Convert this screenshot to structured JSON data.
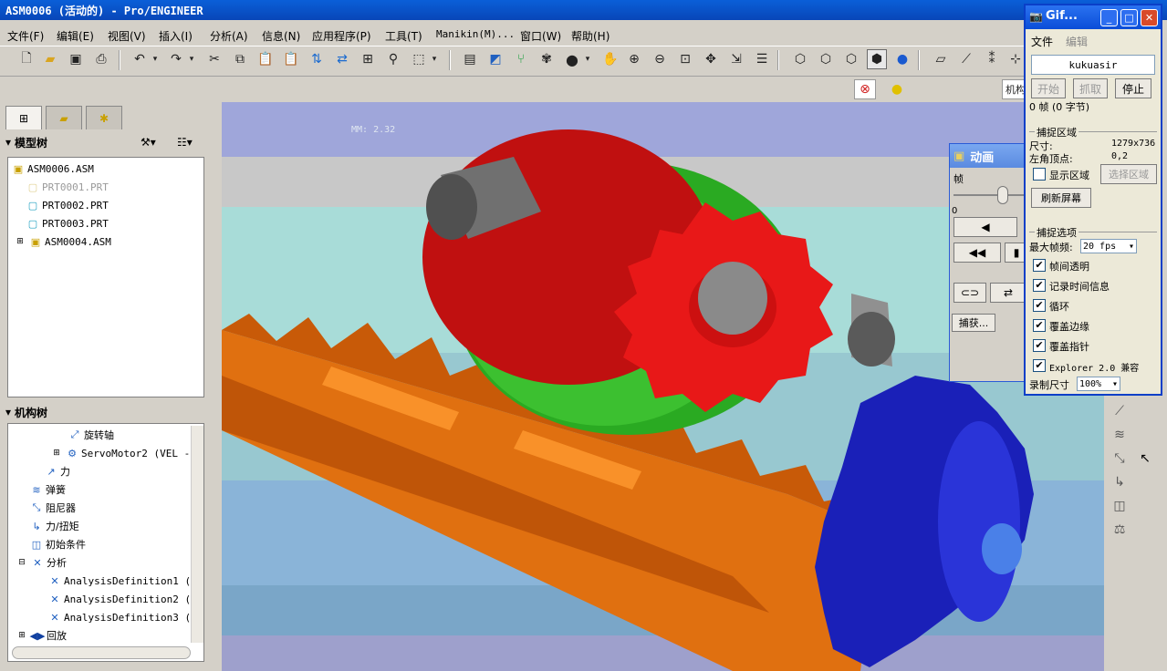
{
  "window": {
    "title": "ASM0006 (活动的) - Pro/ENGINEER"
  },
  "menu": [
    "文件(F)",
    "编辑(E)",
    "视图(V)",
    "插入(I)",
    "分析(A)",
    "信息(N)",
    "应用程序(P)",
    "工具(T)",
    "Manikin(M)...",
    "窗口(W)",
    "帮助(H)"
  ],
  "toolbar2": {
    "mode_label": "机构"
  },
  "model_tree": {
    "header": "模型树",
    "items": [
      "ASM0006.ASM",
      "PRT0001.PRT",
      "PRT0002.PRT",
      "PRT0003.PRT",
      "ASM0004.ASM"
    ]
  },
  "mech_tree": {
    "header": "机构树",
    "items": [
      "旋转轴",
      "ServoMotor2 (VEL -",
      "力",
      "弹簧",
      "阻尼器",
      "力/扭矩",
      "初始条件",
      "分析",
      "AnalysisDefinition1 (",
      "AnalysisDefinition2 (",
      "AnalysisDefinition3 (",
      "回放"
    ]
  },
  "viewport": {
    "mm_label": "MM: 2.32"
  },
  "animation_dialog": {
    "title": "动画",
    "frame_label": "帧",
    "slider_min": "0",
    "capture_button": "捕获..."
  },
  "gif_window": {
    "title": "Gif...",
    "menu": [
      "文件",
      "编辑"
    ],
    "name": "kukuasir",
    "buttons": {
      "start": "开始",
      "grab": "抓取",
      "stop": "停止"
    },
    "status": "0 帧 (0 字节)",
    "capture_area": {
      "group_title": "捕捉区域",
      "size_label": "尺寸:",
      "size_value": "1279x736",
      "corner_label": "左角顶点:",
      "corner_value": "0,2",
      "show_area": "显示区域",
      "select_area": "选择区域",
      "refresh": "刷新屏幕"
    },
    "capture_options": {
      "group_title": "捕捉选项",
      "max_fps_label": "最大帧频:",
      "max_fps_value": "20 fps",
      "options": [
        "帧间透明",
        "记录时间信息",
        "循环",
        "覆盖边缘",
        "覆盖指针",
        "Explorer 2.0 兼容"
      ],
      "record_size_label": "录制尺寸",
      "record_size_value": "100%"
    }
  }
}
